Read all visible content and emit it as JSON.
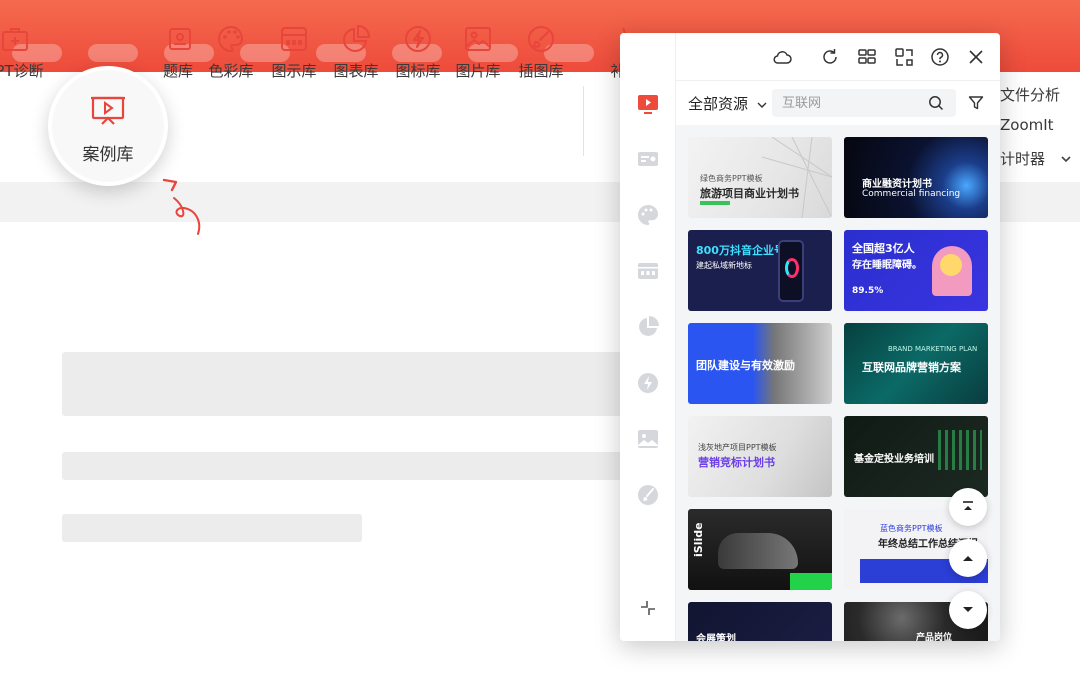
{
  "ribbon": {
    "items": [
      {
        "label": "PPT诊断"
      },
      {
        "label": "案例库"
      },
      {
        "label": "题库"
      },
      {
        "label": "色彩库"
      },
      {
        "label": "图示库"
      },
      {
        "label": "图表库"
      },
      {
        "label": "图标库"
      },
      {
        "label": "图片库"
      },
      {
        "label": "插图库"
      },
      {
        "label": "补"
      }
    ],
    "right_items": [
      {
        "label": "文件分析"
      },
      {
        "label": "ZoomIt"
      },
      {
        "label": "计时器"
      }
    ]
  },
  "highlight": {
    "label": "案例库"
  },
  "panel": {
    "filter_label": "全部资源",
    "search_placeholder": "互联网",
    "cards": [
      {
        "title": "旅游项目商业计划书",
        "subtitle": "绿色商务PPT模板"
      },
      {
        "title": "商业融资计划书",
        "subtitle": "Commercial financing"
      },
      {
        "title": "800万抖音企业号",
        "subtitle": "建起私域新地标"
      },
      {
        "title": "全国超3亿人",
        "subtitle": "存在睡眠障碍。"
      },
      {
        "title": "团队建设与有效激励",
        "subtitle": ""
      },
      {
        "title": "互联网品牌营销方案",
        "subtitle": "BRAND MARKETING PLAN"
      },
      {
        "title": "营销竞标计划书",
        "subtitle": "浅灰地产项目PPT模板"
      },
      {
        "title": "基金定投业务培训",
        "subtitle": ""
      },
      {
        "title": "iSlide",
        "subtitle": ""
      },
      {
        "title": "年终总结工作总结汇报",
        "subtitle": "蓝色商务PPT模板"
      },
      {
        "title": "会展策划",
        "subtitle": ""
      },
      {
        "title": "产品岗位",
        "subtitle": ""
      }
    ],
    "stat": "89.5%"
  },
  "colors": {
    "brand_red": "#ee4b3b",
    "icon_red": "#e8453c"
  }
}
